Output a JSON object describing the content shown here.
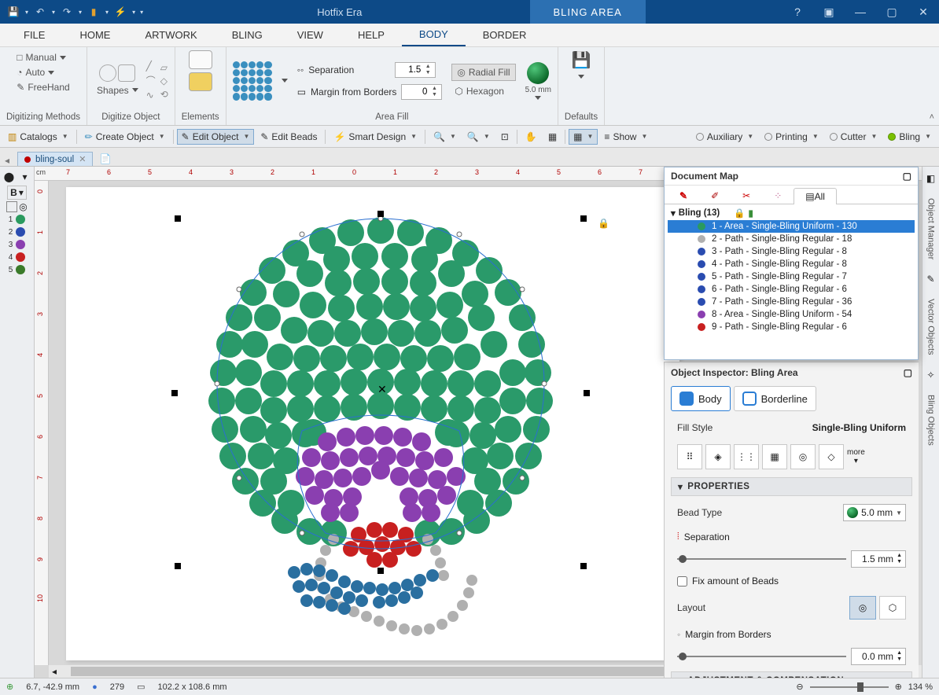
{
  "app_title": "Hotfix Era",
  "context_tab": "BLING AREA",
  "menus": [
    "FILE",
    "HOME",
    "ARTWORK",
    "BLING",
    "VIEW",
    "HELP",
    "BODY",
    "BORDER"
  ],
  "selected_menu": 6,
  "ribbon": {
    "digitizing": {
      "label": "Digitizing Methods",
      "manual": "Manual",
      "auto": "Auto",
      "freehand": "FreeHand"
    },
    "digitize_object": {
      "label": "Digitize Object",
      "shapes": "Shapes"
    },
    "elements": {
      "label": "Elements"
    },
    "area_fill": {
      "label": "Area Fill",
      "separation": "Separation",
      "separation_val": "1.5",
      "margin": "Margin from Borders",
      "margin_val": "0",
      "radial": "Radial Fill",
      "hexagon": "Hexagon",
      "bead_size": "5.0 mm"
    },
    "defaults": {
      "label": "Defaults"
    }
  },
  "toolbar": {
    "catalogs": "Catalogs",
    "create_object": "Create Object",
    "edit_object": "Edit Object",
    "edit_beads": "Edit Beads",
    "smart_design": "Smart Design",
    "show": "Show",
    "auxiliary": "Auxiliary",
    "printing": "Printing",
    "cutter": "Cutter",
    "bling": "Bling"
  },
  "document_tab": "bling-soul",
  "left_colors": [
    {
      "n": "1",
      "c": "#2a9a5f"
    },
    {
      "n": "2",
      "c": "#2a4cb0"
    },
    {
      "n": "3",
      "c": "#8a3fb0"
    },
    {
      "n": "4",
      "c": "#c82020"
    },
    {
      "n": "5",
      "c": "#3a7a2a"
    }
  ],
  "ruler_unit": "cm",
  "hruler_ticks": [
    "7",
    "6",
    "5",
    "4",
    "3",
    "2",
    "1",
    "0",
    "1",
    "2",
    "3",
    "4",
    "5",
    "6",
    "7"
  ],
  "vruler_ticks": [
    "0",
    "1",
    "2",
    "3",
    "4",
    "5",
    "6",
    "7",
    "8",
    "9",
    "10"
  ],
  "panels": {
    "right_tabs": [
      "Object Manager",
      "Vector Objects",
      "Bling Objects"
    ],
    "docmap": {
      "title": "Document Map",
      "tab_labels": {
        "all": "All"
      },
      "root": "Bling (13)",
      "items": [
        "1 - Area - Single-Bling Uniform - 130",
        "2 - Path - Single-Bling Regular - 18",
        "3 - Path - Single-Bling Regular - 8",
        "4 - Path - Single-Bling Regular - 8",
        "5 - Path - Single-Bling Regular - 7",
        "6 - Path - Single-Bling Regular - 6",
        "7 - Path - Single-Bling Regular - 36",
        "8 - Area - Single-Bling Uniform - 54",
        "9 - Path - Single-Bling Regular - 6"
      ],
      "item_colors": [
        "#2a9a5f",
        "#b0b0b0",
        "#2a4cb0",
        "#2a4cb0",
        "#2a4cb0",
        "#2a4cb0",
        "#2a4cb0",
        "#8a3fb0",
        "#c82020"
      ]
    },
    "inspector": {
      "title": "Object Inspector: Bling Area",
      "tabs": {
        "body": "Body",
        "borderline": "Borderline"
      },
      "fill_style_label": "Fill Style",
      "fill_style_value": "Single-Bling Uniform",
      "more": "more",
      "properties": "PROPERTIES",
      "bead_type": "Bead Type",
      "bead_type_val": "5.0 mm",
      "separation": "Separation",
      "separation_val": "1.5 mm",
      "fix_amount": "Fix amount of Beads",
      "layout": "Layout",
      "margin": "Margin from Borders",
      "margin_val": "0.0 mm",
      "adjustment": "ADJUSTMENT & COMPENSATION"
    }
  },
  "status": {
    "coords": "6.7, -42.9 mm",
    "count": "279",
    "size": "102.2 x 108.6 mm",
    "zoom": "134 %"
  }
}
